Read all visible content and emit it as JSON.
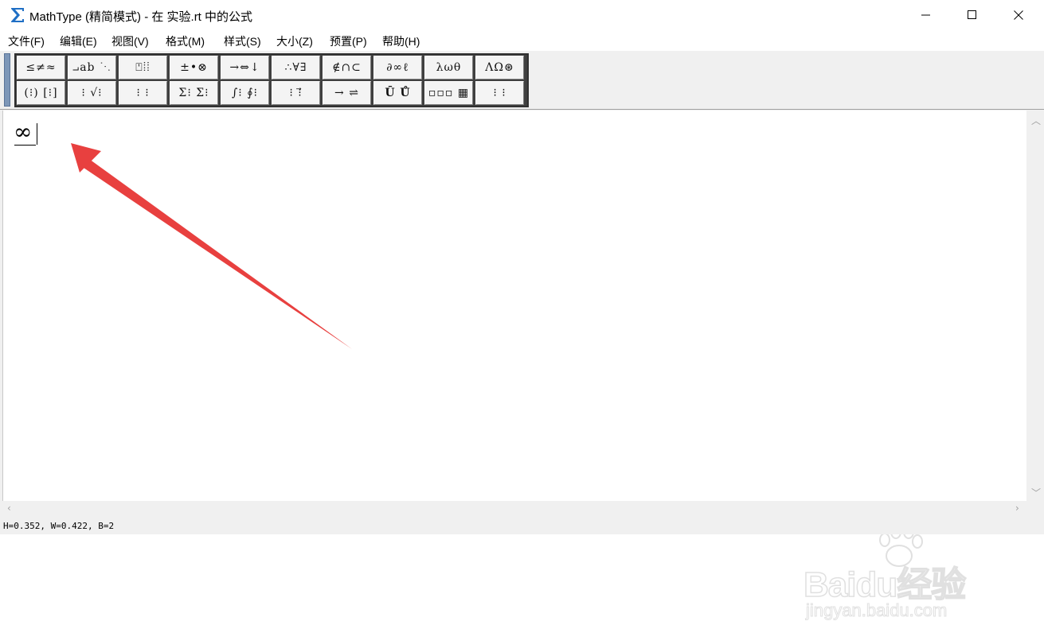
{
  "window": {
    "title": "MathType (精简模式) - 在 实验.rt 中的公式",
    "icon": "sigma-icon",
    "controls": [
      "minimize-icon",
      "maximize-icon",
      "close-icon"
    ]
  },
  "menu": {
    "items": [
      "文件(F)",
      "编辑(E)",
      "视图(V)",
      "格式(M)",
      "样式(S)",
      "大小(Z)",
      "预置(P)",
      "帮助(H)"
    ]
  },
  "toolbar": {
    "row1": [
      "≤≠≈",
      "⨼ab ⋱",
      "⍞⦙⦙",
      "±•⊗",
      "→⇔↓",
      "∴∀∃",
      "∉∩⊂",
      "∂∞ℓ",
      "λωθ",
      "ΛΩ⊛"
    ],
    "row2": [
      "(⁝) [⁝]",
      "⁝ √⁝",
      "⁝ ⁝",
      "Σ⁝ Σ⁝",
      "∫⁝ ∮⁝",
      "⁝ ⁝⃗",
      "→ ⇌",
      "Ū Ů",
      "▫▫▫ ▦",
      "⁝ ⁝"
    ]
  },
  "editor": {
    "formula": "∞"
  },
  "status": {
    "text": "H=0.352, W=0.422, B=2"
  },
  "watermark": {
    "logo": "Baidu经验",
    "url": "jingyan.baidu.com"
  },
  "colors": {
    "arrow": "#e8403f",
    "grip": "#7d97b8",
    "palette_border": "#404040",
    "accent_icon": "#1f6fc5"
  }
}
